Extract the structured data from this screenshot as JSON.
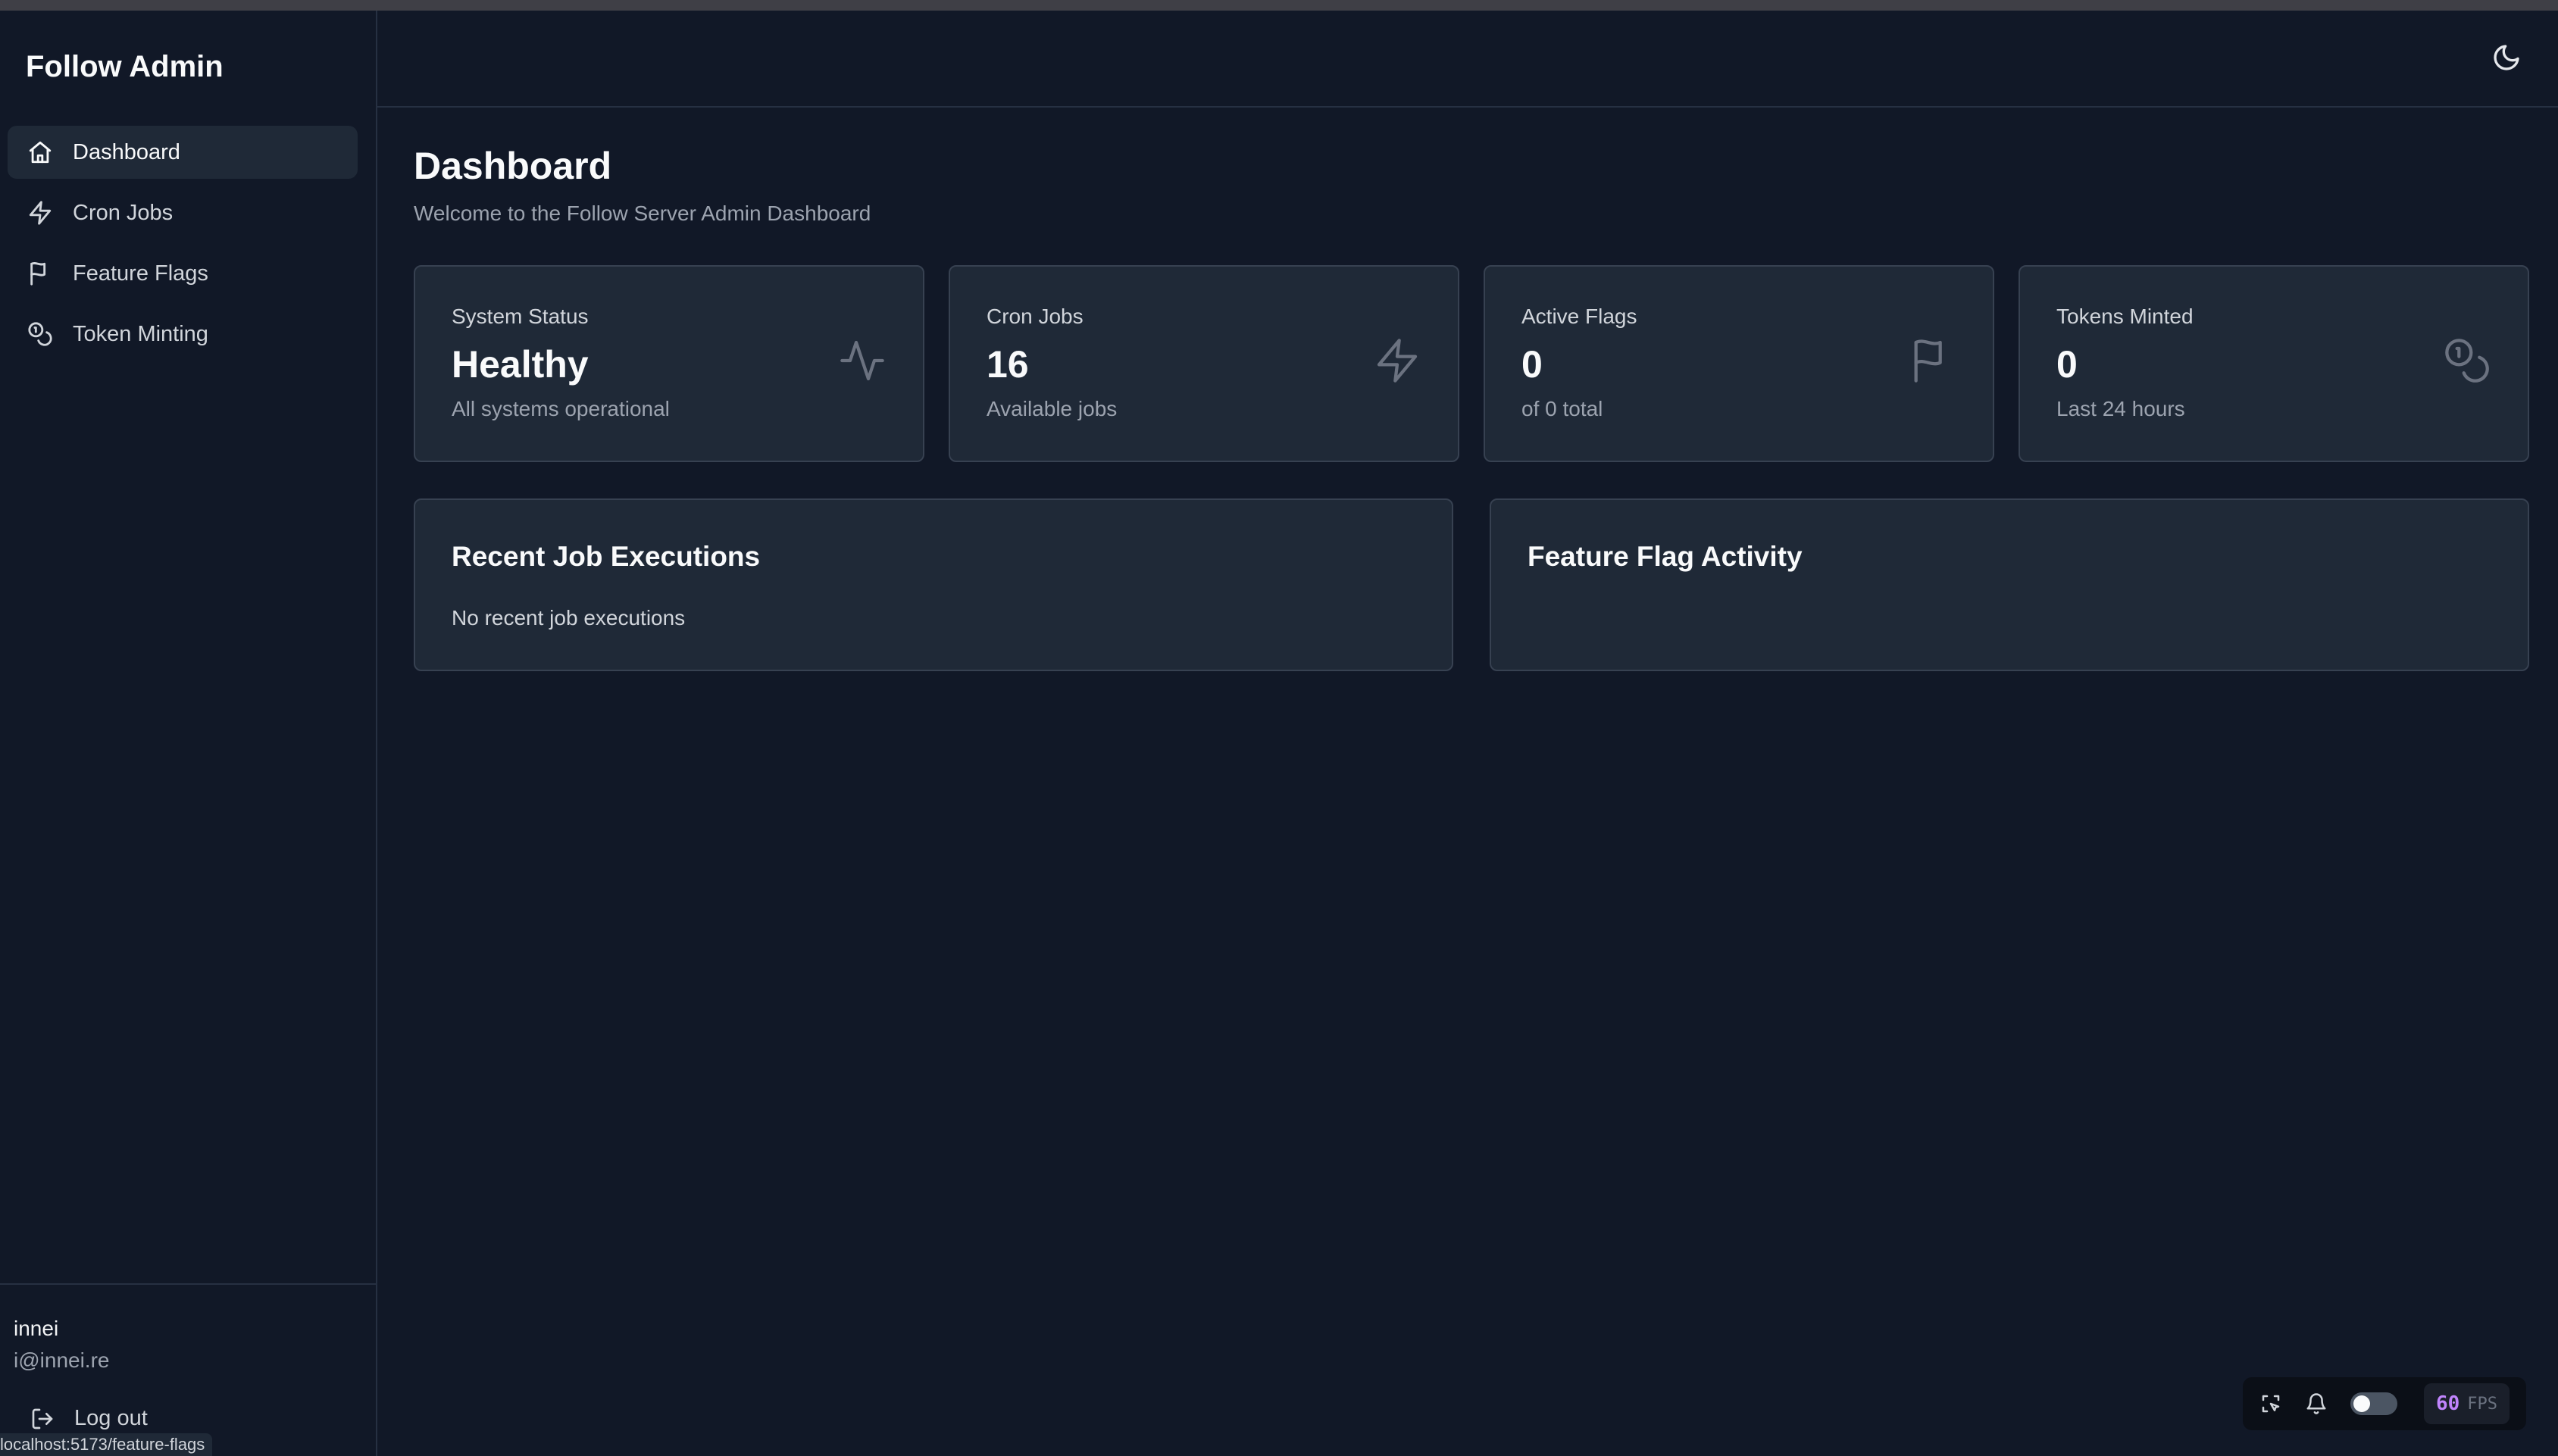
{
  "app": {
    "title": "Follow Admin"
  },
  "sidebar": {
    "items": [
      {
        "label": "Dashboard",
        "icon": "home-icon",
        "active": true
      },
      {
        "label": "Cron Jobs",
        "icon": "zap-icon"
      },
      {
        "label": "Feature Flags",
        "icon": "flag-icon"
      },
      {
        "label": "Token Minting",
        "icon": "coins-icon"
      }
    ],
    "user": {
      "name": "innei",
      "email": "i@innei.re"
    },
    "logout_label": "Log out"
  },
  "status_url": "localhost:5173/feature-flags",
  "header": {
    "theme_icon": "moon-icon"
  },
  "main": {
    "title": "Dashboard",
    "subtitle": "Welcome to the Follow Server Admin Dashboard",
    "stats": [
      {
        "label": "System Status",
        "value": "Healthy",
        "sub": "All systems operational",
        "icon": "activity-icon"
      },
      {
        "label": "Cron Jobs",
        "value": "16",
        "sub": "Available jobs",
        "icon": "zap-icon"
      },
      {
        "label": "Active Flags",
        "value": "0",
        "sub": "of 0 total",
        "icon": "flag-icon"
      },
      {
        "label": "Tokens Minted",
        "value": "0",
        "sub": "Last 24 hours",
        "icon": "coins-icon"
      }
    ],
    "panels": [
      {
        "title": "Recent Job Executions",
        "empty_text": "No recent job executions"
      },
      {
        "title": "Feature Flag Activity",
        "empty_text": ""
      }
    ]
  },
  "devtools": {
    "fps_value": "60",
    "fps_label": "FPS"
  },
  "colors": {
    "background": "#111827",
    "card": "#1f2937",
    "border": "#374151",
    "fps_accent": "#c084fc"
  }
}
